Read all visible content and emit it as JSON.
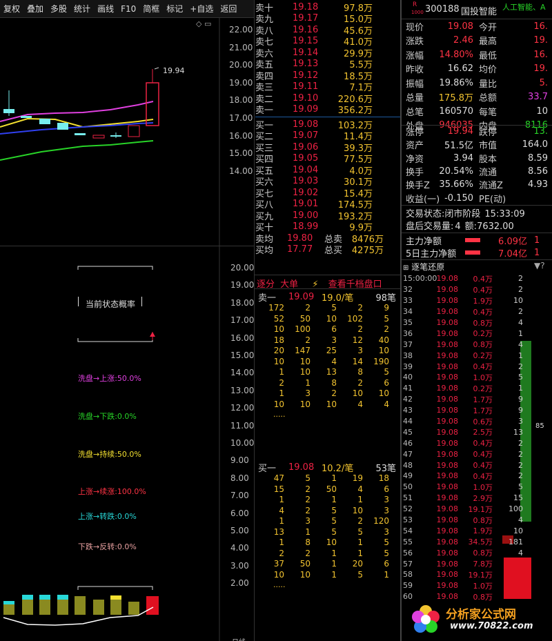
{
  "toolbar": [
    "复权",
    "叠加",
    "多股",
    "统计",
    "画线",
    "F10",
    "简框",
    "标记",
    "+自选",
    "返回"
  ],
  "kline": {
    "price_axis": [
      "22.00",
      "21.00",
      "20.00",
      "19.00",
      "18.00",
      "17.00",
      "16.00",
      "15.00",
      "14.00"
    ],
    "high_label": "19.94"
  },
  "prob": {
    "axis": [
      "20.00",
      "19.00",
      "18.00",
      "17.00",
      "16.00",
      "15.00",
      "14.00",
      "13.00",
      "12.00",
      "11.00",
      "10.00",
      "9.00",
      "8.00",
      "7.00",
      "6.00",
      "5.00",
      "4.00",
      "3.00",
      "2.00"
    ],
    "title": "当前状态概率",
    "items": [
      {
        "text": "洗盘→上涨:50.0%",
        "color": "#e040e0"
      },
      {
        "text": "洗盘→下跌:0.0%",
        "color": "#28d428"
      },
      {
        "text": "洗盘→持续:50.0%",
        "color": "#f3e030"
      },
      {
        "text": "上涨→续涨:100.0%",
        "color": "#ff3344"
      },
      {
        "text": "上涨→转跌:0.0%",
        "color": "#28d8d8"
      },
      {
        "text": "下跌→反转:0.0%",
        "color": "#e8a0a0"
      }
    ],
    "cut": "日线"
  },
  "asks": [
    {
      "l": "卖十",
      "p": "19.18",
      "v": "97.8万"
    },
    {
      "l": "卖九",
      "p": "19.17",
      "v": "15.0万"
    },
    {
      "l": "卖八",
      "p": "19.16",
      "v": "45.6万"
    },
    {
      "l": "卖七",
      "p": "19.15",
      "v": "41.0万"
    },
    {
      "l": "卖六",
      "p": "19.14",
      "v": "29.9万"
    },
    {
      "l": "卖五",
      "p": "19.13",
      "v": "5.5万"
    },
    {
      "l": "卖四",
      "p": "19.12",
      "v": "18.5万"
    },
    {
      "l": "卖三",
      "p": "19.11",
      "v": "7.1万"
    },
    {
      "l": "卖二",
      "p": "19.10",
      "v": "220.6万"
    },
    {
      "l": "卖一",
      "p": "19.09",
      "v": "356.2万"
    }
  ],
  "bids": [
    {
      "l": "买一",
      "p": "19.08",
      "v": "103.2万"
    },
    {
      "l": "买二",
      "p": "19.07",
      "v": "11.4万"
    },
    {
      "l": "买三",
      "p": "19.06",
      "v": "39.3万"
    },
    {
      "l": "买四",
      "p": "19.05",
      "v": "77.5万"
    },
    {
      "l": "买五",
      "p": "19.04",
      "v": "4.0万"
    },
    {
      "l": "买六",
      "p": "19.03",
      "v": "30.1万"
    },
    {
      "l": "买七",
      "p": "19.02",
      "v": "15.4万"
    },
    {
      "l": "买八",
      "p": "19.01",
      "v": "174.5万"
    },
    {
      "l": "买九",
      "p": "19.00",
      "v": "193.2万"
    },
    {
      "l": "买十",
      "p": "18.99",
      "v": "9.9万"
    }
  ],
  "sell_avg": {
    "l": "卖均",
    "p": "19.80",
    "k": "总卖",
    "v": "8476万"
  },
  "buy_avg": {
    "l": "买均",
    "p": "17.77",
    "k": "总买",
    "v": "4275万"
  },
  "queue_tabs": {
    "a": "逐分",
    "b": "大单",
    "c": "查看千档盘口"
  },
  "sell_queue": {
    "label": "卖一",
    "price": "19.09",
    "per": "19.0/笔",
    "count": "98笔",
    "rows": [
      [
        "172",
        "2",
        "5",
        "2",
        "9"
      ],
      [
        "52",
        "50",
        "10",
        "102",
        "5"
      ],
      [
        "10",
        "100",
        "6",
        "2",
        "2"
      ],
      [
        "18",
        "2",
        "3",
        "12",
        "40"
      ],
      [
        "20",
        "147",
        "25",
        "3",
        "10"
      ],
      [
        "10",
        "10",
        "4",
        "14",
        "190"
      ],
      [
        "1",
        "10",
        "13",
        "8",
        "5"
      ],
      [
        "2",
        "1",
        "8",
        "2",
        "6"
      ],
      [
        "1",
        "3",
        "2",
        "10",
        "10"
      ],
      [
        "10",
        "10",
        "10",
        "4",
        "4"
      ]
    ],
    "more": "....."
  },
  "buy_queue": {
    "label": "买一",
    "price": "19.08",
    "per": "10.2/笔",
    "count": "53笔",
    "rows": [
      [
        "47",
        "5",
        "1",
        "19",
        "18"
      ],
      [
        "15",
        "2",
        "50",
        "4",
        "6"
      ],
      [
        "1",
        "2",
        "1",
        "1",
        "3"
      ],
      [
        "4",
        "2",
        "5",
        "10",
        "3"
      ],
      [
        "1",
        "3",
        "5",
        "2",
        "120"
      ],
      [
        "13",
        "1",
        "5",
        "5",
        "3"
      ],
      [
        "1",
        "8",
        "10",
        "1",
        "5"
      ],
      [
        "2",
        "2",
        "1",
        "1",
        "5"
      ],
      [
        "37",
        "50",
        "1",
        "20",
        "6"
      ],
      [
        "10",
        "10",
        "1",
        "5",
        "1"
      ]
    ],
    "more": "....."
  },
  "stock": {
    "tag": "R",
    "code": "300188",
    "name": "国投智能",
    "sector": "人工智能、A"
  },
  "quote": [
    {
      "k": "现价",
      "v": "19.08",
      "c": "red",
      "k2": "今开",
      "v2": "16.",
      "c2": "red"
    },
    {
      "k": "涨跌",
      "v": "2.46",
      "c": "red",
      "k2": "最高",
      "v2": "19.",
      "c2": "red"
    },
    {
      "k": "涨幅",
      "v": "14.80%",
      "c": "red",
      "k2": "最低",
      "v2": "16.",
      "c2": "red"
    },
    {
      "k": "昨收",
      "v": "16.62",
      "c": "wht",
      "k2": "均价",
      "v2": "19.",
      "c2": "red"
    },
    {
      "k": "振幅",
      "v": "19.86%",
      "c": "wht",
      "k2": "量比",
      "v2": "5.",
      "c2": "red"
    },
    {
      "k": "总量",
      "v": "175.8万",
      "c": "yel",
      "k2": "总额",
      "v2": "33.7",
      "c2": "mag"
    },
    {
      "k": "总笔",
      "v": "160570",
      "c": "wht",
      "k2": "每笔",
      "v2": "10",
      "c2": "wht"
    },
    {
      "k": "外盘",
      "v": "946035",
      "c": "red",
      "k2": "内盘",
      "v2": "8116",
      "c2": "grn"
    }
  ],
  "quote2": [
    {
      "k": "涨停",
      "v": "19.94",
      "c": "red",
      "k2": "跌停",
      "v2": "13.",
      "c2": "grn"
    },
    {
      "k": "资产",
      "v": "51.5亿",
      "c": "wht",
      "k2": "市值",
      "v2": "164.0",
      "c2": "wht"
    },
    {
      "k": "净资",
      "v": "3.94",
      "c": "wht",
      "k2": "股本",
      "v2": "8.59",
      "c2": "wht"
    },
    {
      "k": "换手",
      "v": "20.54%",
      "c": "wht",
      "k2": "流通",
      "v2": "8.56",
      "c2": "wht"
    },
    {
      "k": "换手Z",
      "v": "35.66%",
      "c": "wht",
      "k2": "流通Z",
      "v2": "4.93",
      "c2": "wht"
    },
    {
      "k": "收益(一)",
      "v": "-0.150",
      "c": "wht",
      "k2": "PE(动)",
      "v2": "",
      "c2": "wht"
    }
  ],
  "status": {
    "k1": "交易状态:",
    "v1": "闭市阶段",
    "t1": "15:33:09",
    "k2": "盘后交易量:",
    "v2": "4",
    "k3": "额:",
    "v3": "7632.00"
  },
  "flow": [
    {
      "k": "主力净额",
      "v": "6.09亿",
      "tail": "1"
    },
    {
      "k": "5日主力净额",
      "v": "7.04亿",
      "tail": "1"
    }
  ],
  "trades_title": "逐笔还原",
  "trades": [
    [
      "15:00:00",
      "19.08",
      "0.4万",
      "2"
    ],
    [
      "32",
      "19.08",
      "0.4万",
      "2"
    ],
    [
      "33",
      "19.08",
      "1.9万",
      "10"
    ],
    [
      "34",
      "19.08",
      "0.4万",
      "2"
    ],
    [
      "35",
      "19.08",
      "0.8万",
      "4"
    ],
    [
      "36",
      "19.08",
      "0.2万",
      "1"
    ],
    [
      "37",
      "19.08",
      "0.8万",
      "4"
    ],
    [
      "38",
      "19.08",
      "0.2万",
      "1"
    ],
    [
      "39",
      "19.08",
      "0.4万",
      "2"
    ],
    [
      "40",
      "19.08",
      "1.0万",
      "5"
    ],
    [
      "41",
      "19.08",
      "0.2万",
      "1"
    ],
    [
      "42",
      "19.08",
      "1.7万",
      "9"
    ],
    [
      "43",
      "19.08",
      "1.7万",
      "9"
    ],
    [
      "44",
      "19.08",
      "0.6万",
      "3"
    ],
    [
      "45",
      "19.08",
      "2.5万",
      "13"
    ],
    [
      "46",
      "19.08",
      "0.4万",
      "2"
    ],
    [
      "47",
      "19.08",
      "0.4万",
      "2"
    ],
    [
      "48",
      "19.08",
      "0.4万",
      "2"
    ],
    [
      "49",
      "19.08",
      "0.4万",
      "2"
    ],
    [
      "50",
      "19.08",
      "1.0万",
      "5"
    ],
    [
      "51",
      "19.08",
      "2.9万",
      "15"
    ],
    [
      "52",
      "19.08",
      "19.1万",
      "100"
    ],
    [
      "53",
      "19.08",
      "0.8万",
      "4"
    ],
    [
      "54",
      "19.08",
      "1.9万",
      "10"
    ],
    [
      "55",
      "19.08",
      "34.5万",
      "181"
    ],
    [
      "56",
      "19.08",
      "0.8万",
      "4"
    ],
    [
      "57",
      "19.08",
      "7.8万",
      ""
    ],
    [
      "58",
      "19.08",
      "19.1万",
      ""
    ],
    [
      "59",
      "19.08",
      "1.0万",
      ""
    ],
    [
      "60",
      "19.08",
      "0.8万",
      ""
    ]
  ],
  "trades_bar_label": "85",
  "watermark": {
    "title": "分析家公式网",
    "url": "www.70822.com"
  }
}
